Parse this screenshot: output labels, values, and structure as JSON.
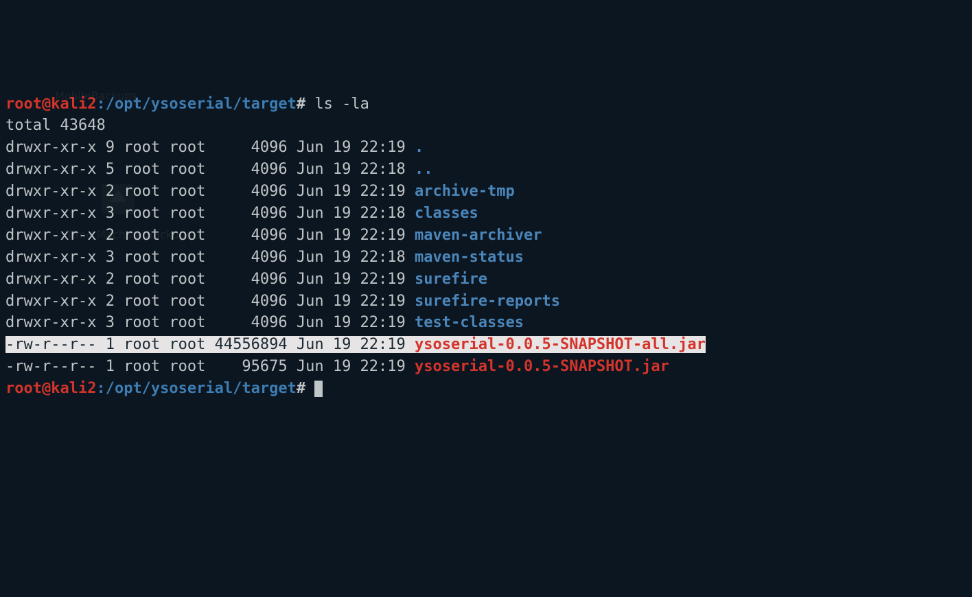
{
  "prompt": {
    "user": "root@kali2",
    "sep1": ":",
    "path": "/opt/ysoserial/target",
    "hash": "#"
  },
  "command1": "ls -la",
  "total_line": "total 43648",
  "rows": [
    {
      "perm": "drwxr-xr-x",
      "links": "9",
      "owner": "root",
      "group": "root",
      "size": "4096",
      "month": "Jun",
      "day": "19",
      "time": "22:19",
      "name": ".",
      "type": "dir"
    },
    {
      "perm": "drwxr-xr-x",
      "links": "5",
      "owner": "root",
      "group": "root",
      "size": "4096",
      "month": "Jun",
      "day": "19",
      "time": "22:18",
      "name": "..",
      "type": "dir"
    },
    {
      "perm": "drwxr-xr-x",
      "links": "2",
      "owner": "root",
      "group": "root",
      "size": "4096",
      "month": "Jun",
      "day": "19",
      "time": "22:19",
      "name": "archive-tmp",
      "type": "dir"
    },
    {
      "perm": "drwxr-xr-x",
      "links": "3",
      "owner": "root",
      "group": "root",
      "size": "4096",
      "month": "Jun",
      "day": "19",
      "time": "22:18",
      "name": "classes",
      "type": "dir"
    },
    {
      "perm": "drwxr-xr-x",
      "links": "2",
      "owner": "root",
      "group": "root",
      "size": "4096",
      "month": "Jun",
      "day": "19",
      "time": "22:19",
      "name": "maven-archiver",
      "type": "dir"
    },
    {
      "perm": "drwxr-xr-x",
      "links": "3",
      "owner": "root",
      "group": "root",
      "size": "4096",
      "month": "Jun",
      "day": "19",
      "time": "22:18",
      "name": "maven-status",
      "type": "dir"
    },
    {
      "perm": "drwxr-xr-x",
      "links": "2",
      "owner": "root",
      "group": "root",
      "size": "4096",
      "month": "Jun",
      "day": "19",
      "time": "22:19",
      "name": "surefire",
      "type": "dir"
    },
    {
      "perm": "drwxr-xr-x",
      "links": "2",
      "owner": "root",
      "group": "root",
      "size": "4096",
      "month": "Jun",
      "day": "19",
      "time": "22:19",
      "name": "surefire-reports",
      "type": "dir"
    },
    {
      "perm": "drwxr-xr-x",
      "links": "3",
      "owner": "root",
      "group": "root",
      "size": "4096",
      "month": "Jun",
      "day": "19",
      "time": "22:19",
      "name": "test-classes",
      "type": "dir"
    },
    {
      "perm": "-rw-r--r--",
      "links": "1",
      "owner": "root",
      "group": "root",
      "size": "44556894",
      "month": "Jun",
      "day": "19",
      "time": "22:19",
      "name": "ysoserial-0.0.5-SNAPSHOT-all.jar",
      "type": "jar-hl"
    },
    {
      "perm": "-rw-r--r--",
      "links": "1",
      "owner": "root",
      "group": "root",
      "size": "95675",
      "month": "Jun",
      "day": "19",
      "time": "22:19",
      "name": "ysoserial-0.0.5-SNAPSHOT.jar",
      "type": "jar"
    }
  ],
  "ghosts": {
    "mb": "MobileBackups",
    "tm": "Time Machine Backups"
  }
}
